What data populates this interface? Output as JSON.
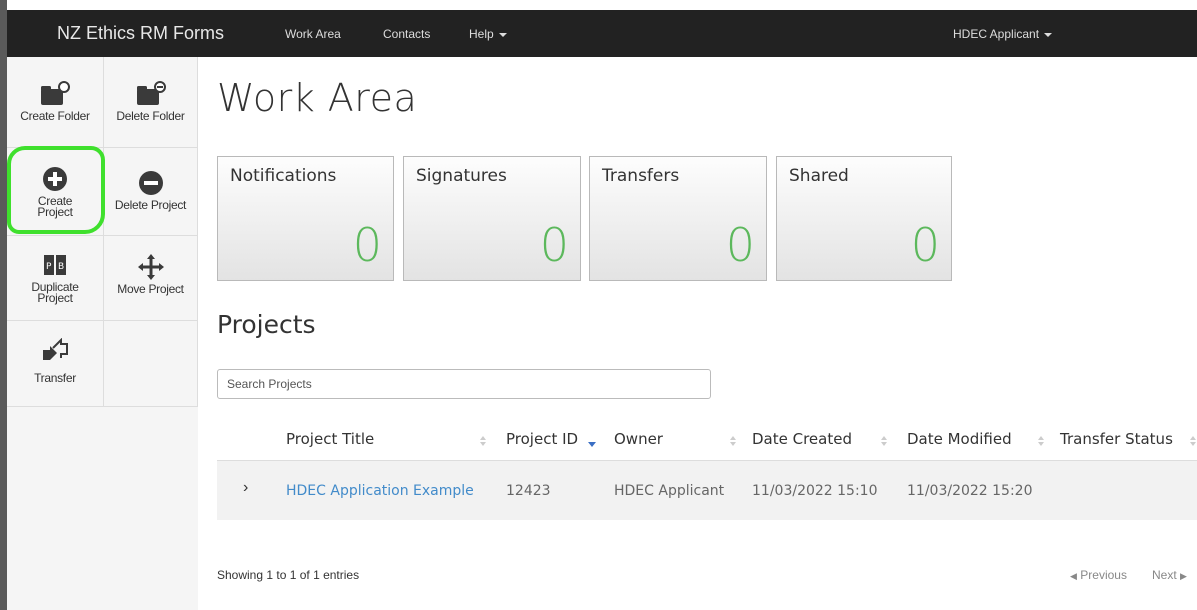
{
  "navbar": {
    "brand": "NZ Ethics RM Forms",
    "links": [
      "Work Area",
      "Contacts",
      "Help"
    ],
    "user": "HDEC Applicant"
  },
  "sidebar": {
    "tools": [
      {
        "label": "Create Folder",
        "icon": "folder-add-icon"
      },
      {
        "label": "Delete Folder",
        "icon": "folder-remove-icon"
      },
      {
        "label": "Create Project",
        "icon": "plus-circle-icon"
      },
      {
        "label": "Delete Project",
        "icon": "minus-circle-icon"
      },
      {
        "label": "Duplicate Project",
        "icon": "duplicate-icon"
      },
      {
        "label": "Move Project",
        "icon": "move-icon"
      },
      {
        "label": "Transfer",
        "icon": "transfer-icon"
      }
    ],
    "highlight_color": "#3fe02d"
  },
  "main": {
    "title": "Work Area",
    "tiles": [
      {
        "label": "Notifications",
        "count": "0"
      },
      {
        "label": "Signatures",
        "count": "0"
      },
      {
        "label": "Transfers",
        "count": "0"
      },
      {
        "label": "Shared",
        "count": "0"
      }
    ],
    "count_color": "#5cb85c",
    "projects_title": "Projects",
    "search_placeholder": "Search Projects",
    "columns": [
      "Project Title",
      "Project ID",
      "Owner",
      "Date Created",
      "Date Modified",
      "Transfer Status"
    ],
    "rows": [
      {
        "title": "HDEC Application Example",
        "id": "12423",
        "owner": "HDEC Applicant",
        "created": "11/03/2022 15:10",
        "modified": "11/03/2022 15:20",
        "transfer_status": ""
      }
    ],
    "info": "Showing 1 to 1 of 1 entries",
    "pager": {
      "previous": "Previous",
      "next": "Next"
    }
  }
}
